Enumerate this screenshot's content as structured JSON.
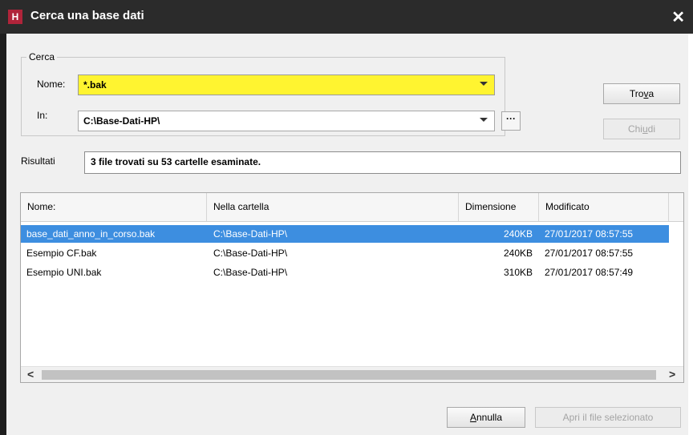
{
  "window": {
    "app_icon_letter": "H",
    "title": "Cerca una base dati",
    "close_glyph": "✕"
  },
  "search_group": {
    "legend": "Cerca",
    "name_label": "Nome:",
    "name_value": "*.bak",
    "in_label": "In:",
    "in_value": "C:\\Base-Dati-HP\\",
    "browse_label": "···"
  },
  "buttons": {
    "find_pre": "Tro",
    "find_mnemonic": "v",
    "find_post": "a",
    "close_pre": "Chi",
    "close_mnemonic": "u",
    "close_post": "di",
    "cancel_mnemonic": "A",
    "cancel_post": "nnulla",
    "open_label": "Apri il file selezionato"
  },
  "results": {
    "label": "Risultati",
    "summary": "3 file trovati su 53 cartelle esaminate."
  },
  "table": {
    "columns": [
      "Nome:",
      "Nella cartella",
      "Dimensione",
      "Modificato"
    ],
    "rows": [
      {
        "name": "base_dati_anno_in_corso.bak",
        "folder": "C:\\Base-Dati-HP\\",
        "size": "240KB",
        "modified": "27/01/2017 08:57:55",
        "selected": true
      },
      {
        "name": "Esempio CF.bak",
        "folder": "C:\\Base-Dati-HP\\",
        "size": "240KB",
        "modified": "27/01/2017 08:57:55",
        "selected": false
      },
      {
        "name": "Esempio UNI.bak",
        "folder": "C:\\Base-Dati-HP\\",
        "size": "310KB",
        "modified": "27/01/2017 08:57:49",
        "selected": false
      }
    ],
    "scroll_left_glyph": "<",
    "scroll_right_glyph": ">"
  },
  "colors": {
    "titlebar": "#2b2b2b",
    "app_icon": "#b0243a",
    "name_field_highlight": "#fff430",
    "selection": "#3d8ee0"
  }
}
